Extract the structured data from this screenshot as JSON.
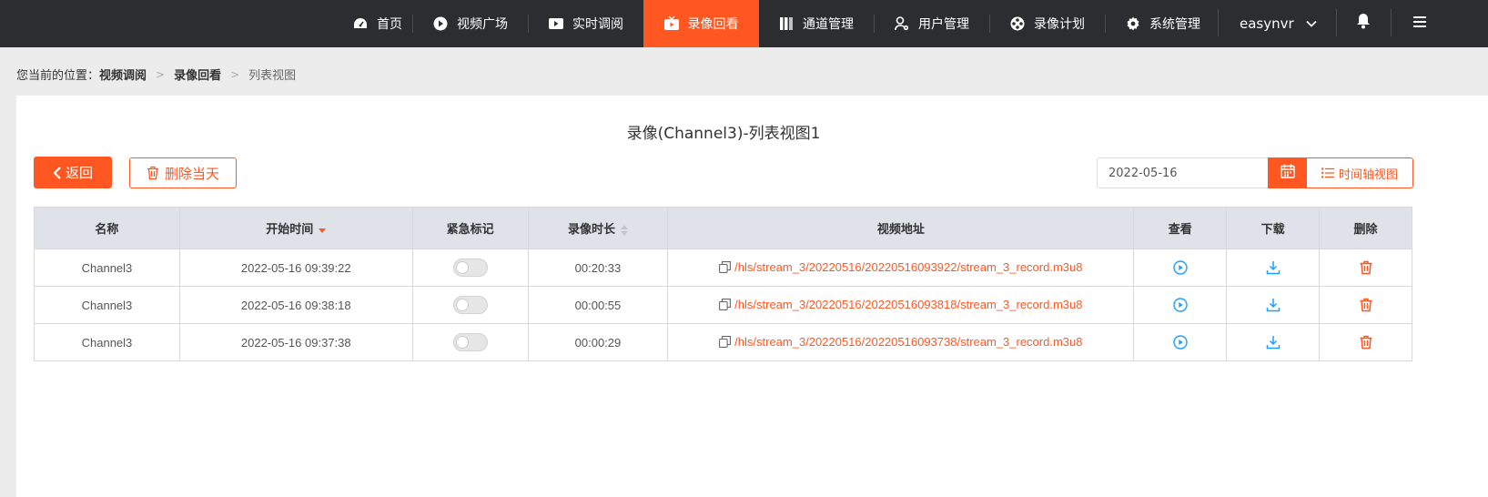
{
  "nav": {
    "items": [
      {
        "label": "首页",
        "icon": "dashboard-icon"
      },
      {
        "label": "视频广场",
        "icon": "play-circle-icon"
      },
      {
        "label": "实时调阅",
        "icon": "video-camera-icon"
      },
      {
        "label": "录像回看",
        "icon": "playback-icon",
        "active": true
      },
      {
        "label": "通道管理",
        "icon": "channels-icon"
      },
      {
        "label": "用户管理",
        "icon": "user-gear-icon"
      },
      {
        "label": "录像计划",
        "icon": "film-reel-icon"
      },
      {
        "label": "系统管理",
        "icon": "gear-icon"
      }
    ],
    "username": "easynvr"
  },
  "breadcrumb": {
    "prefix": "您当前的位置：",
    "items": [
      "视频调阅",
      "录像回看",
      "列表视图"
    ]
  },
  "page": {
    "title": "录像(Channel3)-列表视图1",
    "back_label": "返回",
    "delete_day_label": "删除当天",
    "date_value": "2022-05-16",
    "timeline_label": "时间轴视图"
  },
  "table": {
    "headers": [
      "名称",
      "开始时间",
      "紧急标记",
      "录像时长",
      "视频地址",
      "查看",
      "下载",
      "删除"
    ],
    "rows": [
      {
        "name": "Channel3",
        "start": "2022-05-16 09:39:22",
        "duration": "00:20:33",
        "url": "/hls/stream_3/20220516/20220516093922/stream_3_record.m3u8"
      },
      {
        "name": "Channel3",
        "start": "2022-05-16 09:38:18",
        "duration": "00:00:55",
        "url": "/hls/stream_3/20220516/20220516093818/stream_3_record.m3u8"
      },
      {
        "name": "Channel3",
        "start": "2022-05-16 09:37:38",
        "duration": "00:00:29",
        "url": "/hls/stream_3/20220516/20220516093738/stream_3_record.m3u8"
      }
    ]
  },
  "colors": {
    "accent": "#ff5722",
    "topbar": "#2b2d30",
    "link": "#ff5722",
    "action_blue": "#1e9fff",
    "delete_red": "#ff5722"
  }
}
